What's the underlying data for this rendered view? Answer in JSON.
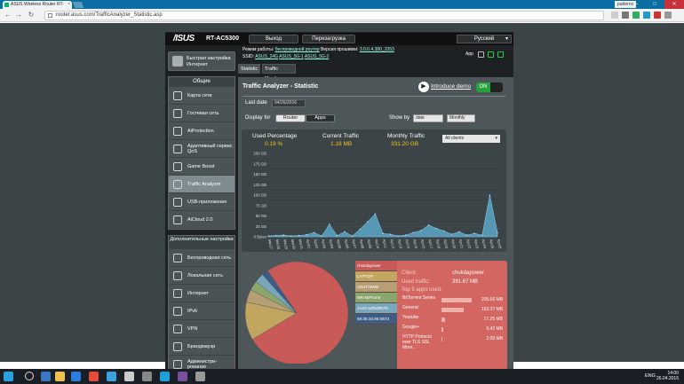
{
  "browser": {
    "tab_title": "ASUS Wireless Router RT-",
    "profile": "patterns",
    "url": "router.asus.com/TrafficAnalyzer_Statistic.asp",
    "win_min": "—",
    "win_max": "□",
    "win_close": "✕"
  },
  "header": {
    "logo": "/ISUS",
    "model": "RT-AC5300",
    "logout": "Выход",
    "reboot": "Перезагрузка",
    "language": "Русский",
    "mode_label": "Режим работы:",
    "mode_value": "беспроводной роутер",
    "fw_label": "Версия прошивки:",
    "fw_value": "3.0.0.4.380_3353",
    "ssid_label": "SSID:",
    "ssids": [
      "ASUS_24G",
      "ASUS_5G-1",
      "ASUS_5G-2"
    ],
    "app_label": "App"
  },
  "sidebar": {
    "quick_setup": "Быстрая настройка Интернет",
    "general_header": "Общие",
    "general": [
      "Карта сети",
      "Гостевая сеть",
      "AiProtection",
      "Адаптивный сервис QoS",
      "Game Boost",
      "Traffic Analyzer",
      "USB-приложение",
      "AiCloud 2.0"
    ],
    "advanced_header": "Дополнительные настройки",
    "advanced": [
      "Беспроводная сеть",
      "Локальная сеть",
      "Интернет",
      "IPv6",
      "VPN",
      "Брандмауэр",
      "Администри-рование"
    ]
  },
  "subtabs": [
    "Statistic",
    "Traffic Monitor"
  ],
  "main": {
    "title": "Traffic Analyzer - Statistic",
    "intro": "Introduce demo",
    "toggle": "ON",
    "last_date_label": "Last date",
    "last_date": "04/26/2016",
    "display_for_label": "Display for",
    "display_router": "Router",
    "display_apps": "Apps",
    "show_by_label": "Show by",
    "show_by": "date",
    "period": "Monthly",
    "used_pct_label": "Used Percentage",
    "used_pct": "0.19 %",
    "current_label": "Current Traffic",
    "current": "1.18 MB",
    "monthly_label": "Monthly Traffic",
    "monthly": "331.20 GB",
    "clients_select": "All clients"
  },
  "chart_data": {
    "type": "area",
    "yticks": [
      "200 GB",
      "175 GB",
      "150 GB",
      "125 GB",
      "100 GB",
      "75 GB",
      "50 GB",
      "25 GB",
      "0 Bytes"
    ],
    "ylim": [
      0,
      200
    ],
    "x": [
      "Mar 27",
      "Mar 28",
      "Mar 29",
      "Mar 30",
      "Mar 31",
      "Apr 1",
      "Apr 2",
      "Apr 3",
      "Apr 4",
      "Apr 5",
      "Apr 6",
      "Apr 7",
      "Apr 8",
      "Apr 9",
      "Apr 10",
      "Apr 11",
      "Apr 12",
      "Apr 13",
      "Apr 14",
      "Apr 15",
      "Apr 16",
      "Apr 17",
      "Apr 18",
      "Apr 19",
      "Apr 20",
      "Apr 21",
      "Apr 22",
      "Apr 23",
      "Apr 24",
      "Apr 25",
      "Apr 26"
    ],
    "xtick_labels": [
      "Mar27",
      "Mar28",
      "Mar29",
      "Mar30",
      "Mar31",
      "Apr01",
      "Apr02",
      "Apr03",
      "Apr04",
      "Apr05",
      "Apr06",
      "Apr07",
      "Apr08",
      "Apr09",
      "Apr10",
      "Apr11",
      "Apr12",
      "Apr13",
      "Apr14",
      "Apr15",
      "Apr16",
      "Apr17",
      "Apr18",
      "Apr19",
      "Apr20",
      "Apr21",
      "Apr22",
      "Apr23",
      "Apr24",
      "Apr25",
      "Apr26"
    ],
    "values": [
      2,
      3,
      4,
      2,
      3,
      5,
      10,
      2,
      30,
      3,
      12,
      2,
      18,
      36,
      55,
      8,
      6,
      2,
      4,
      10,
      15,
      28,
      20,
      14,
      6,
      12,
      4,
      8,
      4,
      100,
      10
    ],
    "fill": "#5aa6c9"
  },
  "pie": {
    "slices": [
      {
        "label": "chukdapower",
        "value": 76,
        "color": "#c95a57"
      },
      {
        "label": "LAPTOP-",
        "value": 12,
        "color": "#c2a55f"
      },
      {
        "label": "A3LR7MMB",
        "value": 4,
        "color": "#b79f74"
      },
      {
        "label": "MR-MiPhone",
        "value": 3,
        "color": "#8ba66a"
      },
      {
        "label": "JAZZ-a4fbd8f578",
        "value": 3,
        "color": "#7aa6bb"
      },
      {
        "label": "58:3E:34:9E:8573",
        "value": 2,
        "color": "#3f5c85"
      }
    ]
  },
  "detail": {
    "client_label": "Client:",
    "client": "chukdapower",
    "used_label": "Used traffic:",
    "used": "391.67 MB",
    "top5_label": "Top 5 apps used:",
    "apps": [
      {
        "name": "BitTorrent Series",
        "value": "205.66 MB",
        "frac": 0.62
      },
      {
        "name": "General",
        "value": "153.37 MB",
        "frac": 0.46
      },
      {
        "name": "Youtube",
        "value": "17.25 MB",
        "frac": 0.07
      },
      {
        "name": "Google+",
        "value": "9.42 MB",
        "frac": 0.04
      },
      {
        "name": "HTTP Protocol over TLS SSL",
        "value": "2.09 MB",
        "frac": 0.02
      }
    ],
    "more": "More.."
  },
  "taskbar": {
    "lang": "ENG",
    "time": "14:00",
    "date": "26.04.2016"
  }
}
